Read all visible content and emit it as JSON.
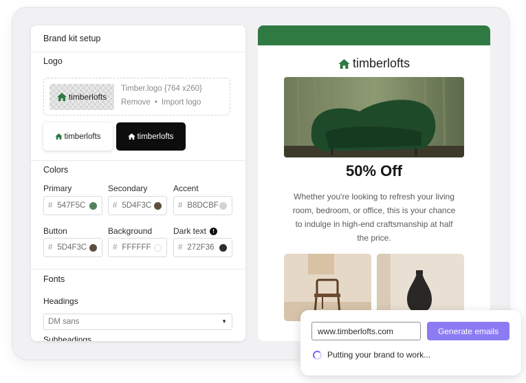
{
  "brand_kit": {
    "title": "Brand kit setup",
    "logo_section": {
      "label": "Logo",
      "wordmark": "timberlofts",
      "file_info": "Timber.logo {764 x260}",
      "remove_label": "Remove",
      "separator": "•",
      "import_label": "Import logo"
    },
    "colors_section": {
      "label": "Colors",
      "hash": "#",
      "fields": [
        {
          "label": "Primary",
          "value": "547F5C",
          "swatch": "#547F5C"
        },
        {
          "label": "Secondary",
          "value": "5D4F3C",
          "swatch": "#5D4F3C"
        },
        {
          "label": "Accent",
          "value": "B8DCBF",
          "swatch": "#D3D3D3"
        },
        {
          "label": "Button",
          "value": "5D4F3C",
          "swatch": "#5D4F3C"
        },
        {
          "label": "Background",
          "value": "FFFFFF",
          "swatch": "#FFFFFF"
        },
        {
          "label": "Dark text",
          "value": "272F36",
          "swatch": "#272F36",
          "warning": "!"
        }
      ]
    },
    "fonts_section": {
      "label": "Fonts",
      "headings_label": "Headings",
      "headings_value": "DM sans",
      "subheadings_label": "Subheadings"
    }
  },
  "email_preview": {
    "brand_color": "#2F7A42",
    "wordmark": "timberlofts",
    "headline": "50% Off",
    "body_lines": [
      "Whether you're looking to refresh your living",
      "room, bedroom, or office, this is your chance",
      "to indulge in high-end craftsmanship at half",
      "the price."
    ]
  },
  "generator": {
    "url_value": "www.timberlofts.com",
    "button_label": "Generate emails",
    "status_text": "Putting your brand to work...",
    "accent": "#8B7CF4"
  }
}
